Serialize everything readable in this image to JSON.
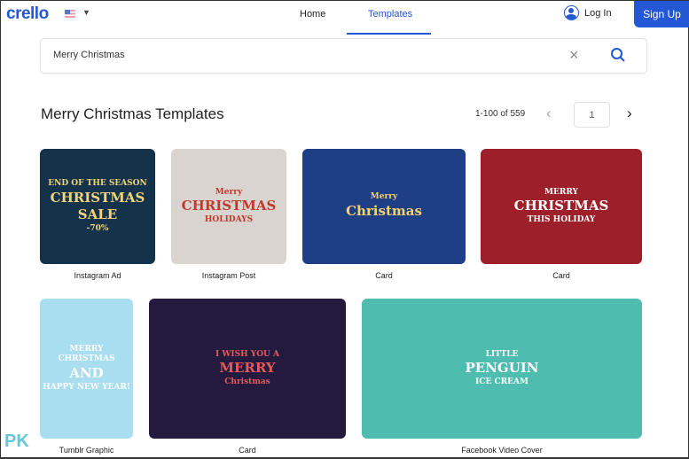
{
  "header": {
    "logo": "crello",
    "nav": [
      {
        "label": "Home"
      },
      {
        "label": "Templates",
        "active": true
      }
    ],
    "login": "Log In",
    "signup": "Sign Up",
    "accent": "#2457d6"
  },
  "search": {
    "value": "Merry Christmas",
    "placeholder": ""
  },
  "results": {
    "title": "Merry Christmas Templates",
    "count": "1-100 of 559",
    "page": "1"
  },
  "templates": [
    {
      "type": "Instagram Ad",
      "art": [
        "END OF THE SEASON",
        "CHRISTMAS SALE",
        "-70%"
      ],
      "bg": "#14324a"
    },
    {
      "type": "Instagram Post",
      "art": [
        "Merry",
        "CHRISTMAS",
        "HOLIDAYS"
      ],
      "bg": "#d9d4cf"
    },
    {
      "type": "Card",
      "art": [
        "Merry",
        "Christmas"
      ],
      "bg": "#1e3f86"
    },
    {
      "type": "Card",
      "art": [
        "MERRY",
        "CHRISTMAS",
        "THIS HOLIDAY"
      ],
      "bg": "#9c1f2a"
    },
    {
      "type": "Tumblr Graphic",
      "art": [
        "MERRY CHRISTMAS",
        "AND",
        "HAPPY NEW YEAR!"
      ],
      "bg": "#a8def0"
    },
    {
      "type": "Card",
      "art": [
        "I WISH YOU A",
        "MERRY",
        "Christmas"
      ],
      "bg": "#231a3d"
    },
    {
      "type": "Facebook Video Cover",
      "art": [
        "LITTLE",
        "PENGUIN",
        "ICE CREAM"
      ],
      "bg": "#4fbcb0"
    }
  ],
  "watermark": "PK"
}
